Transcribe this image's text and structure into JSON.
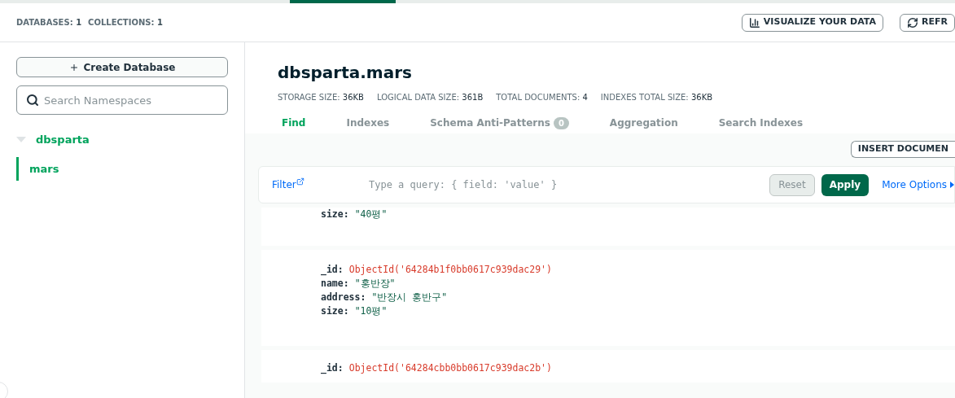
{
  "header": {
    "stats": [
      {
        "label": "DATABASES:",
        "value": "1"
      },
      {
        "label": "COLLECTIONS:",
        "value": "1"
      }
    ],
    "buttons": [
      {
        "label": "VISUALIZE YOUR DATA",
        "kind": "chart"
      },
      {
        "label": "REFR",
        "kind": "refresh"
      }
    ]
  },
  "sidebar": {
    "create_button": "Create Database",
    "search": {
      "placeholder": "Search Namespaces"
    },
    "tree": [
      {
        "label": "dbsparta",
        "expanded": true,
        "selected": false,
        "children": [
          {
            "label": "mars",
            "selected": true
          }
        ]
      }
    ]
  },
  "collection": {
    "title": "dbsparta.mars",
    "stats": [
      {
        "label": "STORAGE SIZE:",
        "value": "36KB"
      },
      {
        "label": "LOGICAL DATA SIZE:",
        "value": "361B"
      },
      {
        "label": "TOTAL DOCUMENTS:",
        "value": "4"
      },
      {
        "label": "INDEXES TOTAL SIZE:",
        "value": "36KB"
      }
    ],
    "tabs": [
      {
        "label": "Find",
        "selected": true
      },
      {
        "label": "Indexes",
        "selected": false
      },
      {
        "label": "Schema Anti-Patterns",
        "badge": "0",
        "selected": false
      },
      {
        "label": "Aggregation",
        "selected": false
      },
      {
        "label": "Search Indexes",
        "selected": false
      }
    ],
    "insert_button": "INSERT DOCUMEN",
    "filter": {
      "label": "Filter",
      "placeholder": "Type a query: { field: 'value' }",
      "reset": "Reset",
      "apply": "Apply",
      "more": "More Options"
    },
    "documents": [
      {
        "fields": [
          {
            "key": "size:",
            "value": "\"40평\"",
            "kind": "string"
          }
        ]
      },
      {
        "fields": [
          {
            "key": "_id:",
            "value": "ObjectId('64284b1f0bb0617c939dac29')",
            "kind": "objectid"
          },
          {
            "key": "name:",
            "value": "\"홍반장\"",
            "kind": "string"
          },
          {
            "key": "address:",
            "value": "\"반장시 홍반구\"",
            "kind": "string"
          },
          {
            "key": "size:",
            "value": "\"10평\"",
            "kind": "string"
          }
        ]
      },
      {
        "fields": [
          {
            "key": "_id:",
            "value": "ObjectId('64284cbb0bb0617c939dac2b')",
            "kind": "objectid"
          }
        ]
      }
    ]
  }
}
